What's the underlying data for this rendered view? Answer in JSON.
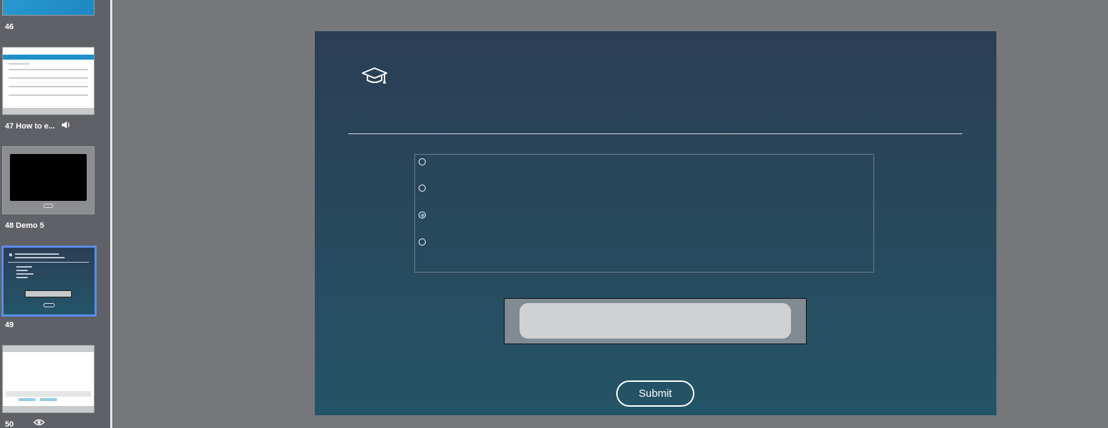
{
  "filmstrip": {
    "slides": [
      {
        "label": "46"
      },
      {
        "label": "47 How to e...",
        "audio_icon": "speaker-icon"
      },
      {
        "label": "48 Demo 5"
      },
      {
        "label": "49",
        "selected": true
      },
      {
        "label": "50",
        "visibility_icon": "eye-icon"
      }
    ]
  },
  "slide": {
    "icon": "graduation-cap-icon",
    "options": [
      {
        "label": "",
        "checked": false
      },
      {
        "label": "",
        "checked": false
      },
      {
        "label": "",
        "checked": true
      },
      {
        "label": "",
        "checked": false
      }
    ],
    "submit_label": "Submit"
  },
  "colors": {
    "selection_border": "#5a8dea",
    "slide_top": "#2a3e55",
    "slide_bottom": "#245467",
    "canvas_bg": "#75777b"
  }
}
